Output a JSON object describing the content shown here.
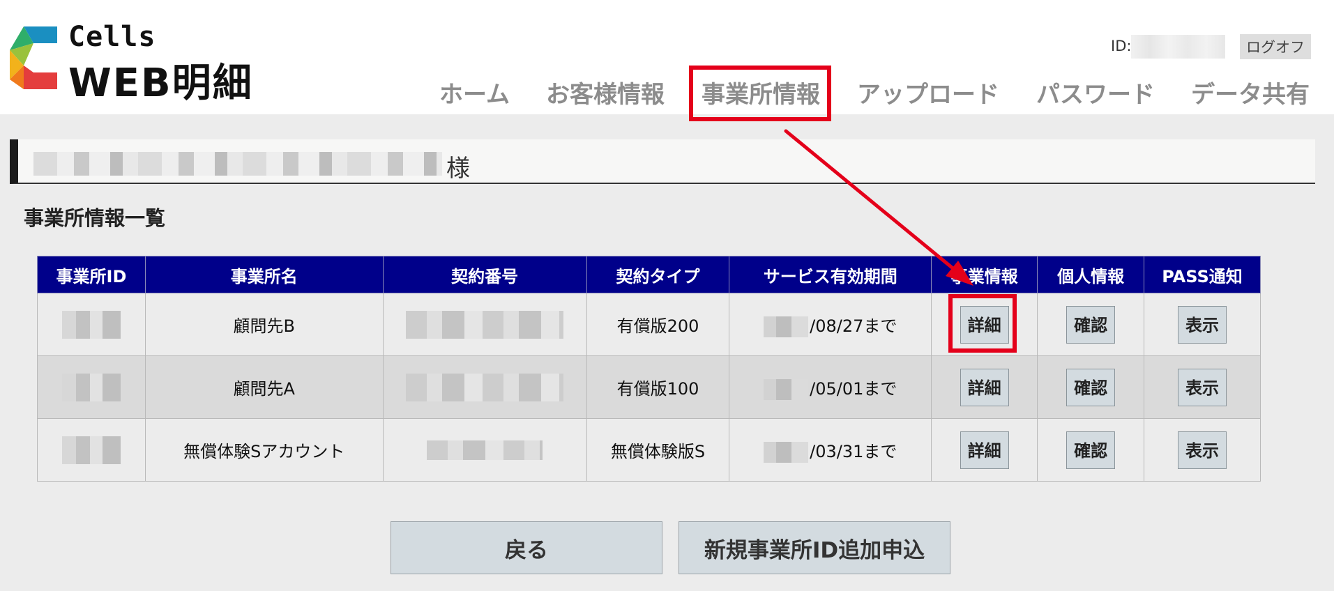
{
  "logo": {
    "line1": "Cells",
    "line2": "WEB明細"
  },
  "account": {
    "id_label": "ID:",
    "logoff_label": "ログオフ"
  },
  "nav": {
    "items": [
      "ホーム",
      "お客様情報",
      "事業所情報",
      "アップロード",
      "パスワード",
      "データ共有"
    ],
    "active_index": 2
  },
  "customer": {
    "suffix": "様"
  },
  "section": {
    "title": "事業所情報一覧"
  },
  "table": {
    "headers": [
      "事業所ID",
      "事業所名",
      "契約番号",
      "契約タイプ",
      "サービス有効期間",
      "事業情報",
      "個人情報",
      "PASS通知"
    ],
    "rows": [
      {
        "name": "顧問先B",
        "type": "有償版200",
        "period": "/08/27まで",
        "detail": "詳細",
        "confirm": "確認",
        "show": "表示"
      },
      {
        "name": "顧問先A",
        "type": "有償版100",
        "period": "/05/01まで",
        "detail": "詳細",
        "confirm": "確認",
        "show": "表示"
      },
      {
        "name": "無償体験Sアカウント",
        "type": "無償体験版S",
        "period": "/03/31まで",
        "detail": "詳細",
        "confirm": "確認",
        "show": "表示"
      }
    ]
  },
  "buttons": {
    "back": "戻る",
    "add_office": "新規事業所ID追加申込"
  },
  "colors": {
    "table_header": "#00008a",
    "highlight": "#e4001a",
    "button": "#d3dbe0"
  }
}
